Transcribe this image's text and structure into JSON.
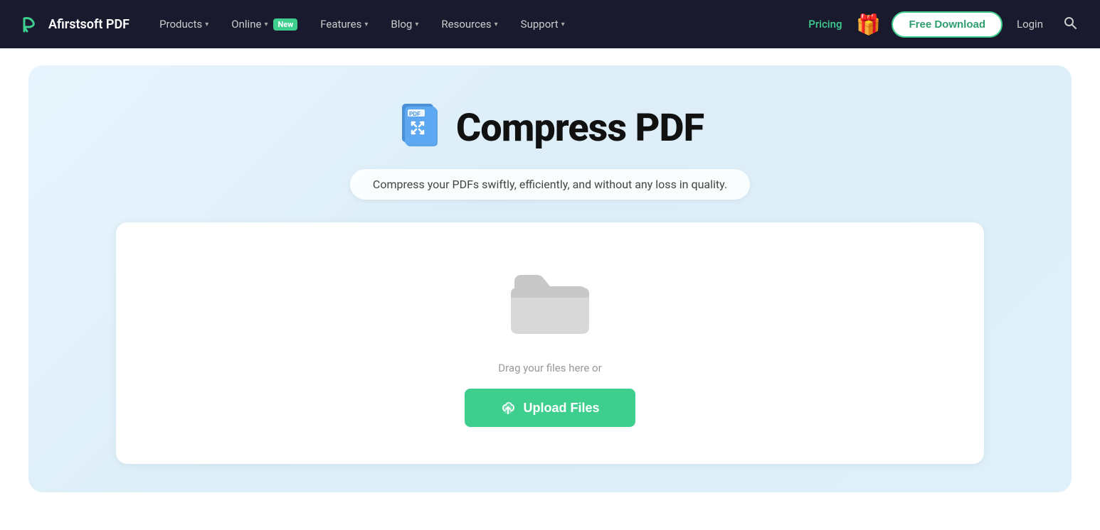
{
  "navbar": {
    "logo_text": "Afirstsoft PDF",
    "items": [
      {
        "label": "Products",
        "has_chevron": true,
        "has_new": false
      },
      {
        "label": "Online",
        "has_chevron": true,
        "has_new": true
      },
      {
        "label": "Features",
        "has_chevron": true,
        "has_new": false
      },
      {
        "label": "Blog",
        "has_chevron": true,
        "has_new": false
      },
      {
        "label": "Resources",
        "has_chevron": true,
        "has_new": false
      },
      {
        "label": "Support",
        "has_chevron": true,
        "has_new": false
      }
    ],
    "pricing_label": "Pricing",
    "free_download_label": "Free Download",
    "login_label": "Login",
    "new_badge": "New"
  },
  "hero": {
    "title": "Compress PDF",
    "subtitle": "Compress your PDFs swiftly, efficiently, and without any loss in quality.",
    "drag_text": "Drag your files here or",
    "upload_btn_label": "Upload Files"
  },
  "colors": {
    "accent_green": "#3ecf8e",
    "pricing_green": "#3ecf8e",
    "navbar_bg": "#1a1a2e",
    "hero_bg_start": "#e8f4fd",
    "hero_bg_end": "#ddeef8"
  }
}
